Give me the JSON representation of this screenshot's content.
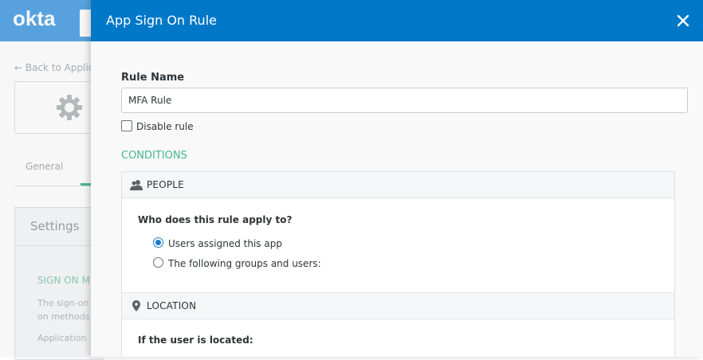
{
  "background": {
    "logo": "okta",
    "back_link": "← Back to Applic",
    "tab_general": "General",
    "settings_title": "Settings",
    "sign_on_heading": "SIGN ON M",
    "text_line1": "The sign-on",
    "text_line2": "on methods",
    "text_line3": "Application"
  },
  "modal": {
    "title": "App Sign On Rule",
    "rule_name_label": "Rule Name",
    "rule_name_value": "MFA Rule",
    "disable_rule_label": "Disable rule",
    "disable_rule_checked": false,
    "conditions_heading": "CONDITIONS",
    "people": {
      "title": "PEOPLE",
      "question": "Who does this rule apply to?",
      "options": [
        {
          "label": "Users assigned this app",
          "checked": true
        },
        {
          "label": "The following groups and users:",
          "checked": false
        }
      ]
    },
    "location": {
      "title": "LOCATION",
      "question": "If the user is located:"
    }
  },
  "colors": {
    "header_blue": "#0078c8",
    "accent_green": "#44b78b",
    "radio_blue": "#1d7acc"
  }
}
